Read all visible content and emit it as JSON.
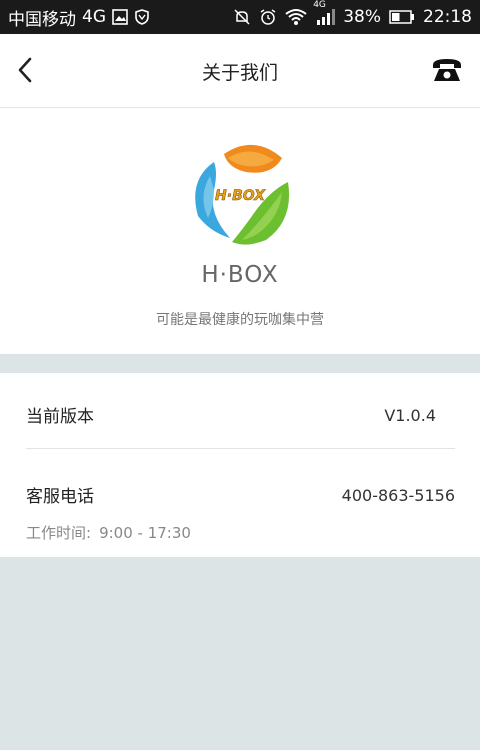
{
  "status_bar": {
    "carrier": "中国移动",
    "network": "4G",
    "network_small": "4G",
    "battery": "38%",
    "time": "22:18"
  },
  "nav": {
    "title": "关于我们",
    "back_icon": "chevron-left-icon",
    "phone_icon": "telephone-icon"
  },
  "about": {
    "app_name": "H·BOX",
    "logo_text": "H·BOX",
    "slogan": "可能是最健康的玩咖集中营"
  },
  "info": {
    "version_label": "当前版本",
    "version_value": "V1.0.4",
    "phone_label": "客服电话",
    "phone_value": "400-863-5156",
    "hours_label": "工作时间:",
    "hours_value": "9:00 - 17:30"
  },
  "colors": {
    "background": "#dde4e6",
    "card": "#ffffff",
    "logo_orange": "#f08a1c",
    "logo_green": "#6cbf2e",
    "logo_blue": "#3aa8df"
  }
}
